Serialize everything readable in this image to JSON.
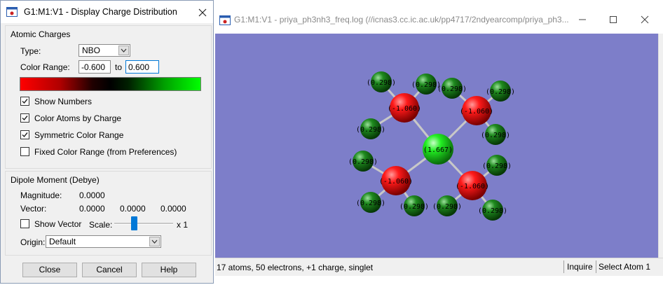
{
  "dialog": {
    "title": "G1:M1:V1 - Display Charge Distribution",
    "atomic_charges": {
      "group_title": "Atomic Charges",
      "type_label": "Type:",
      "type_value": "NBO",
      "color_range_label": "Color Range:",
      "range_min": "-0.600",
      "range_to": "to",
      "range_max": "0.600",
      "gradient_colors": [
        "#ff0000",
        "#000000",
        "#00ff00"
      ],
      "options": [
        {
          "label": "Show Numbers",
          "checked": true
        },
        {
          "label": "Color Atoms by Charge",
          "checked": true
        },
        {
          "label": "Symmetric Color Range",
          "checked": true
        },
        {
          "label": "Fixed Color Range (from Preferences)",
          "checked": false
        }
      ]
    },
    "dipole": {
      "group_title": "Dipole Moment (Debye)",
      "magnitude_label": "Magnitude:",
      "magnitude_value": "0.0000",
      "vector_label": "Vector:",
      "vector_values": [
        "0.0000",
        "0.0000",
        "0.0000"
      ],
      "show_vector_label": "Show Vector",
      "show_vector_checked": false,
      "scale_label": "Scale:",
      "scale_value": "x 1",
      "origin_label": "Origin:",
      "origin_value": "Default"
    },
    "buttons": {
      "close": "Close",
      "cancel": "Cancel",
      "help": "Help"
    }
  },
  "viewer": {
    "title": "G1:M1:V1 - priya_ph3nh3_freq.log (//icnas3.cc.ic.ac.uk/pp4717/2ndyearcomp/priya_ph3...",
    "background_color": "#7d7ec9",
    "status_text": "17 atoms, 50 electrons, +1 charge, singlet",
    "status_mode": "Inquire",
    "status_action": "Select Atom 1",
    "molecule": {
      "center_atom": {
        "label": "(1.667)",
        "color": "#22dd22"
      },
      "n_atoms": [
        {
          "label": "(-1.060)",
          "color": "#e00000"
        },
        {
          "label": "(-1.060)",
          "color": "#e00000"
        },
        {
          "label": "(-1.060)",
          "color": "#e00000"
        },
        {
          "label": "(-1.060)",
          "color": "#e00000"
        }
      ],
      "h_atoms": [
        {
          "label": "(0.298)",
          "color": "#1a7a1a"
        },
        {
          "label": "(0.298)",
          "color": "#1a7a1a"
        },
        {
          "label": "(0.298)",
          "color": "#1a7a1a"
        },
        {
          "label": "(0.298)",
          "color": "#1a7a1a"
        },
        {
          "label": "(0.298)",
          "color": "#1a7a1a"
        },
        {
          "label": "(0.298)",
          "color": "#1a7a1a"
        },
        {
          "label": "(0.298)",
          "color": "#1a7a1a"
        },
        {
          "label": "(0.298)",
          "color": "#1a7a1a"
        },
        {
          "label": "(0.298)",
          "color": "#1a7a1a"
        },
        {
          "label": "(0.298)",
          "color": "#1a7a1a"
        },
        {
          "label": "(0.298)",
          "color": "#1a7a1a"
        },
        {
          "label": "(0.298)",
          "color": "#1a7a1a"
        }
      ]
    }
  }
}
